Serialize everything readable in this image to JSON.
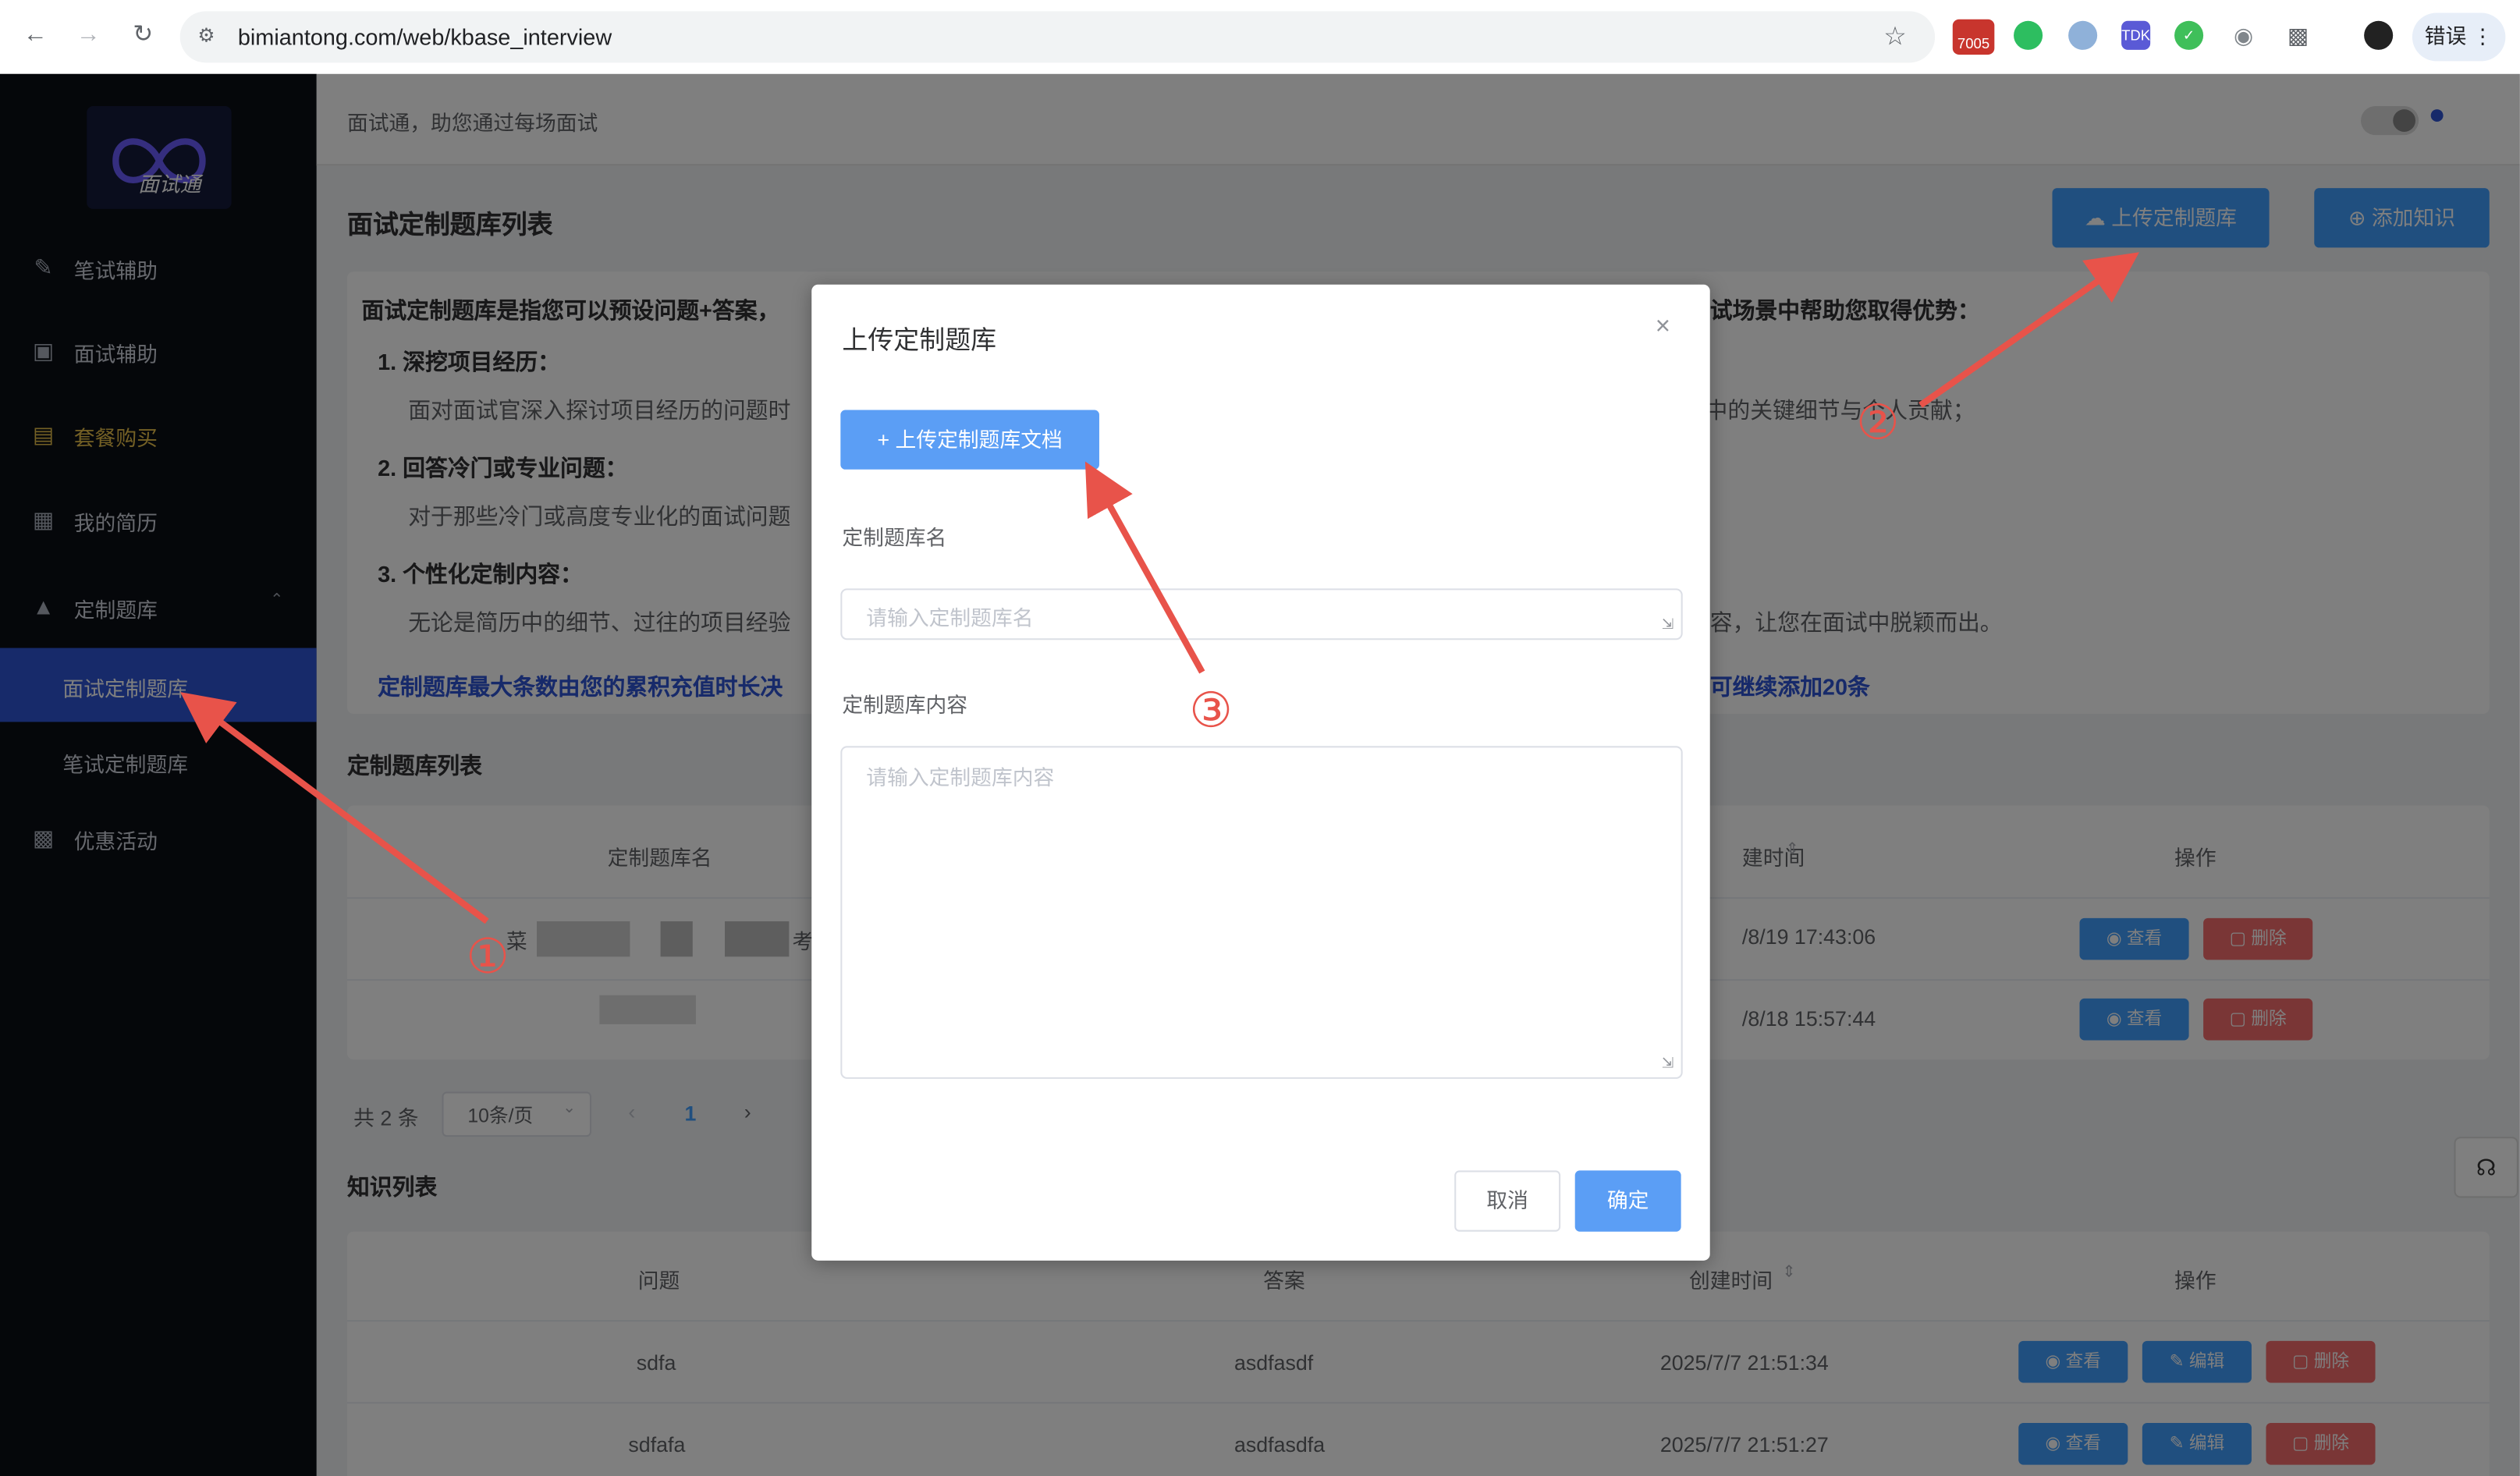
{
  "browser": {
    "url": "bimiantong.com/web/kbase_interview",
    "badge_text": "7005",
    "error_label": "错误",
    "icons": [
      "back-icon",
      "forward-icon",
      "reload-icon",
      "site-settings-icon",
      "bookmark-star-icon",
      "extension-icon",
      "profile-icon",
      "more-icon"
    ]
  },
  "sidebar": {
    "logo_text": "面试通",
    "items": [
      {
        "label": "笔试辅助",
        "icon": "pen-user-icon"
      },
      {
        "label": "面试辅助",
        "icon": "monitor-icon"
      },
      {
        "label": "套餐购买",
        "icon": "bag-icon"
      },
      {
        "label": "我的简历",
        "icon": "resume-icon"
      },
      {
        "label": "定制题库",
        "icon": "graduation-cap-icon"
      },
      {
        "label": "面试定制题库",
        "icon": ""
      },
      {
        "label": "笔试定制题库",
        "icon": ""
      },
      {
        "label": "优惠活动",
        "icon": "gift-icon"
      }
    ]
  },
  "header": {
    "subtitle": "面试通，助您通过每场面试"
  },
  "page": {
    "title": "面试定制题库列表",
    "upload_btn": "上传定制题库",
    "add_knowledge_btn": "添加知识",
    "intro": {
      "lead_left": "面试定制题库是指您可以预设问题+答案，",
      "lead_right": "试场景中帮助您取得优势：",
      "point1_title": "1. 深挖项目经历：",
      "point1_left": "面对面试官深入探讨项目经历的问题时",
      "point1_right": "中的关键细节与个人贡献；",
      "point2_title": "2. 回答冷门或专业问题：",
      "point2_left": "对于那些冷门或高度专业化的面试问题",
      "point3_title": "3. 个性化定制内容：",
      "point3_left": "无论是简历中的细节、过往的项目经验",
      "point3_right": "容，让您在面试中脱颖而出。",
      "note_left": "定制题库最大条数由您的累积充值时长决",
      "note_right": "可继续添加20条"
    },
    "bank_list": {
      "title": "定制题库列表",
      "headers": [
        "定制题库名",
        "建时间",
        "操作"
      ],
      "rows": [
        {
          "name_visible": "菜",
          "name_suffix": "考",
          "time": "/8/19 17:43:06"
        },
        {
          "name_visible": "",
          "name_suffix": "",
          "time": "/8/18 15:57:44"
        }
      ],
      "view_label": "查看",
      "delete_label": "删除"
    },
    "pagination": {
      "total": "共 2 条",
      "page_size": "10条/页",
      "current_page": "1"
    },
    "knowledge": {
      "title": "知识列表",
      "headers": [
        "问题",
        "答案",
        "创建时间",
        "操作"
      ],
      "rows": [
        {
          "q": "sdfa",
          "a": "asdfasdf",
          "time": "2025/7/7 21:51:34"
        },
        {
          "q": "sdfafa",
          "a": "asdfasdfa",
          "time": "2025/7/7 21:51:27"
        }
      ],
      "view_label": "查看",
      "edit_label": "编辑",
      "delete_label": "删除"
    }
  },
  "dialog": {
    "title": "上传定制题库",
    "upload_doc_btn": "上传定制题库文档",
    "name_label": "定制题库名",
    "name_placeholder": "请输入定制题库名",
    "content_label": "定制题库内容",
    "content_placeholder": "请输入定制题库内容",
    "cancel": "取消",
    "confirm": "确定"
  },
  "annotations": {
    "marker1": "①",
    "marker2": "②",
    "marker3": "③",
    "color": "#e8534a"
  }
}
